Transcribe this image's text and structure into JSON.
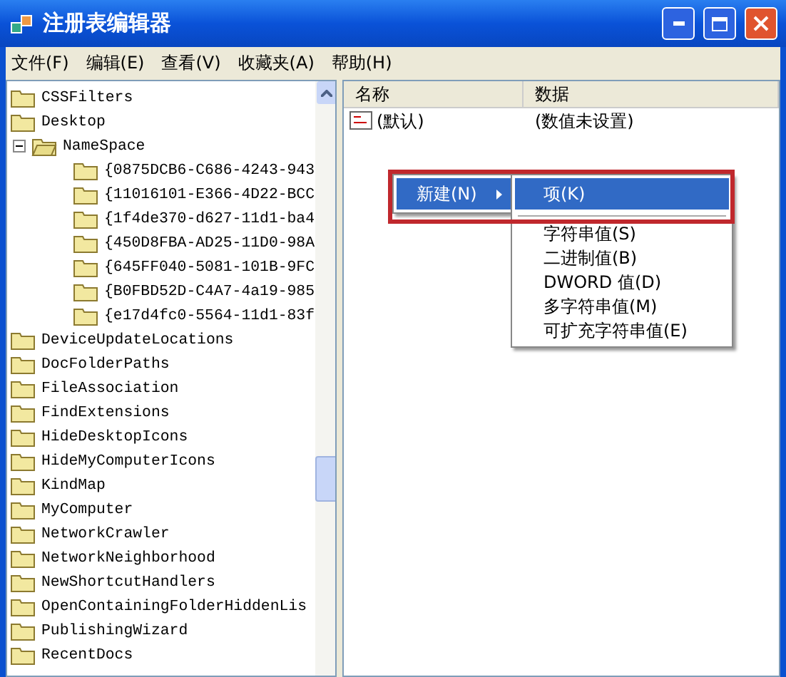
{
  "window": {
    "title": "注册表编辑器"
  },
  "menu_bar": [
    "文件(F)",
    "编辑(E)",
    "查看(V)",
    "收藏夹(A)",
    "帮助(H)"
  ],
  "tree": [
    {
      "label": "CSSFilters"
    },
    {
      "label": "Desktop",
      "children": [
        {
          "label": "NameSpace",
          "expanded": true,
          "children": [
            {
              "label": "{0875DCB6-C686-4243-943"
            },
            {
              "label": "{11016101-E366-4D22-BCC"
            },
            {
              "label": "{1f4de370-d627-11d1-ba4"
            },
            {
              "label": "{450D8FBA-AD25-11D0-98A"
            },
            {
              "label": "{645FF040-5081-101B-9FC"
            },
            {
              "label": "{B0FBD52D-C4A7-4a19-985"
            },
            {
              "label": "{e17d4fc0-5564-11d1-83f"
            }
          ]
        }
      ]
    },
    {
      "label": "DeviceUpdateLocations"
    },
    {
      "label": "DocFolderPaths"
    },
    {
      "label": "FileAssociation"
    },
    {
      "label": "FindExtensions"
    },
    {
      "label": "HideDesktopIcons"
    },
    {
      "label": "HideMyComputerIcons"
    },
    {
      "label": "KindMap"
    },
    {
      "label": "MyComputer"
    },
    {
      "label": "NetworkCrawler"
    },
    {
      "label": "NetworkNeighborhood"
    },
    {
      "label": "NewShortcutHandlers"
    },
    {
      "label": "OpenContainingFolderHiddenLis"
    },
    {
      "label": "PublishingWizard"
    },
    {
      "label": "RecentDocs"
    }
  ],
  "list": {
    "columns": [
      "名称",
      "数据"
    ],
    "rows": [
      {
        "name": "(默认)",
        "data": "(数值未设置)"
      }
    ]
  },
  "context_menu": {
    "items": [
      {
        "label": "新建(N)",
        "selected": true,
        "submenu": true
      }
    ]
  },
  "submenu": {
    "items": [
      {
        "label": "项(K)",
        "selected": true
      },
      {
        "kind": "separator"
      },
      {
        "label": "字符串值(S)",
        "selected": false
      },
      {
        "label": "二进制值(B)",
        "selected": false
      },
      {
        "label": "DWORD 值(D)",
        "selected": false
      },
      {
        "label": "多字符串值(M)",
        "selected": false
      },
      {
        "label": "可扩充字符串值(E)",
        "selected": false
      }
    ]
  }
}
